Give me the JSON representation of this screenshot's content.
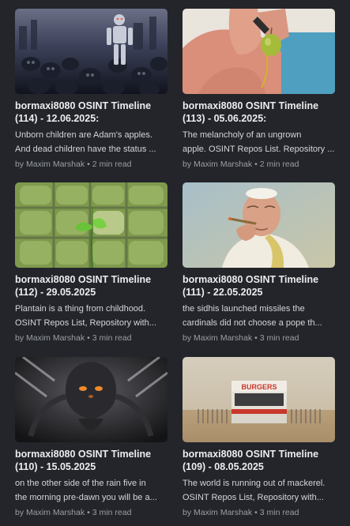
{
  "posts": [
    {
      "title": "bormaxi8080 OSINT Timeline (114) - 12.06.2025:",
      "excerpt_line1": "Unborn children are Adam's apples.",
      "excerpt_line2": "And dead children have the status ...",
      "author": "by Maxim Marshak",
      "read_time": "2 min read",
      "image": "robot-over-skulls-image"
    },
    {
      "title": "bormaxi8080 OSINT Timeline (113) - 05.06.2025:",
      "excerpt_line1": "The melancholy of an ungrown",
      "excerpt_line2": "apple. OSINT Repos List. Repository ...",
      "author": "by Maxim Marshak",
      "read_time": "2 min read",
      "image": "hand-holding-green-fruit-image"
    },
    {
      "title": "bormaxi8080 OSINT Timeline (112) - 29.05.2025",
      "excerpt_line1": "Plantain is a thing from childhood.",
      "excerpt_line2": "OSINT Repos List, Repository with...",
      "author": "by Maxim Marshak",
      "read_time": "3 min read",
      "image": "sprout-through-fence-image"
    },
    {
      "title": "bormaxi8080 OSINT Timeline (111) - 22.05.2025",
      "excerpt_line1": "the sidhis launched missiles the",
      "excerpt_line2": "cardinals did not choose a pope th...",
      "author": "by Maxim Marshak",
      "read_time": "3 min read",
      "image": "pope-smoking-image"
    },
    {
      "title": "bormaxi8080 OSINT Timeline (110) - 15.05.2025",
      "excerpt_line1": "on the other side of the rain five in",
      "excerpt_line2": "the morning pre-dawn you will be a...",
      "author": "by Maxim Marshak",
      "read_time": "3 min read",
      "image": "alien-creature-image"
    },
    {
      "title": "bormaxi8080 OSINT Timeline (109) - 08.05.2025",
      "excerpt_line1": "The world is running out of mackerel.",
      "excerpt_line2": "OSINT Repos List, Repository with...",
      "author": "by Maxim Marshak",
      "read_time": "3 min read",
      "image": "burgers-kiosk-image",
      "image_sign": "BURGERS"
    }
  ]
}
